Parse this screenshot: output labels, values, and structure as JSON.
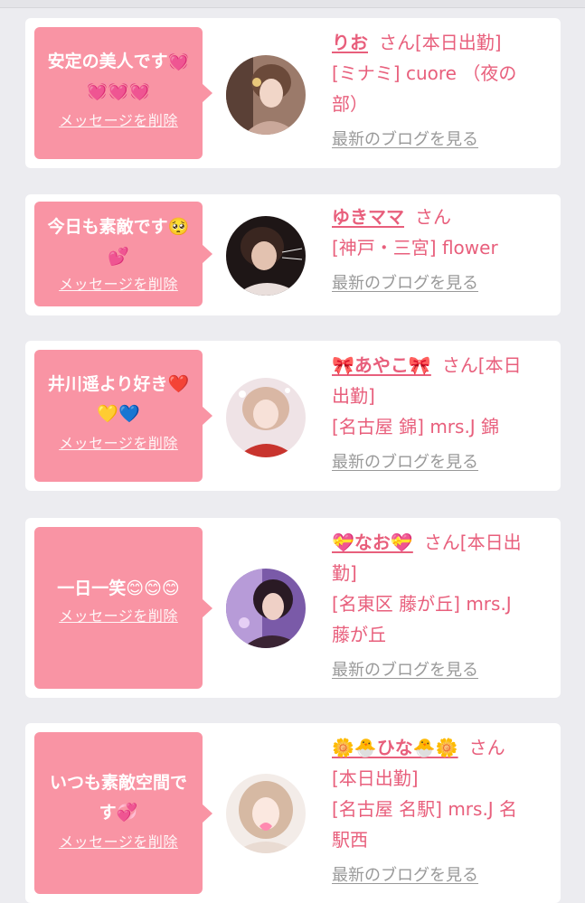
{
  "colors": {
    "page_bg": "#ececf0",
    "card_bg": "#ffffff",
    "bubble_bg": "#f994a4",
    "accent_text": "#e85f7c",
    "link_gray": "#999999"
  },
  "delete_label": "メッセージを削除",
  "blog_label": "最新のブログを見る",
  "san_suffix": "さん",
  "cards": [
    {
      "message_line1": "安定の美人です💓",
      "message_line2": "💓💓💓",
      "name": "りお",
      "status_suffix": "さん[本日出勤]",
      "shop_line1": "[ミナミ] cuore （夜の",
      "shop_line2": "部）"
    },
    {
      "message_line1": "今日も素敵です🥺",
      "message_line2": "💕",
      "name": "ゆきママ",
      "status_suffix": "さん",
      "shop_line1": "[神戸・三宮] flower",
      "shop_line2": ""
    },
    {
      "message_line1": "井川遥より好き❤️",
      "message_line2": "💛💙",
      "name": "🎀あやこ🎀",
      "status_suffix": "さん[本日",
      "status_line2": "出勤]",
      "shop_line1": "[名古屋 錦] mrs.J 錦",
      "shop_line2": ""
    },
    {
      "message_line1": "一日一笑😊😊😊",
      "message_line2": "",
      "name": "💝なお💝",
      "status_suffix": "さん[本日出",
      "status_line2": "勤]",
      "shop_line1": "[名東区 藤が丘] mrs.J",
      "shop_line2": "藤が丘"
    },
    {
      "message_line1": "いつも素敵空間で",
      "message_line2": "す💞",
      "name": "🌼🐣ひな🐣🌼",
      "status_suffix": "さん",
      "status_line2": "[本日出勤]",
      "shop_line1": "[名古屋 名駅] mrs.J 名",
      "shop_line2": "駅西"
    }
  ]
}
